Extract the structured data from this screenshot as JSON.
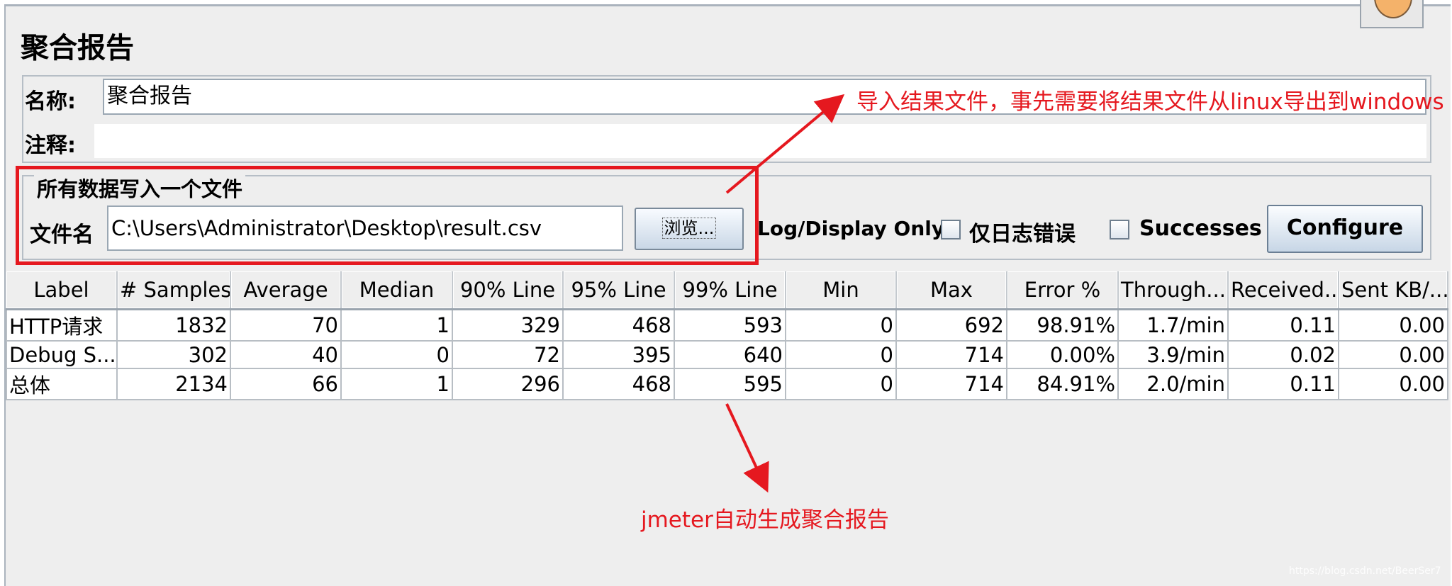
{
  "panel": {
    "title": "聚合报告",
    "name_label": "名称:",
    "name_value": "聚合报告",
    "comment_label": "注释:",
    "comment_value": ""
  },
  "file_group": {
    "title": "所有数据写入一个文件",
    "filename_label": "文件名",
    "filename_value": "C:\\Users\\Administrator\\Desktop\\result.csv",
    "browse_label": "浏览...",
    "log_display_label": "Log/Display Only:",
    "errors_label": "仅日志错误",
    "successes_label": "Successes",
    "configure_label": "Configure"
  },
  "table": {
    "headers": [
      "Label",
      "# Samples",
      "Average",
      "Median",
      "90% Line",
      "95% Line",
      "99% Line",
      "Min",
      "Max",
      "Error %",
      "Through...",
      "Received...",
      "Sent KB/..."
    ],
    "rows": [
      [
        "HTTP请求",
        "1832",
        "70",
        "1",
        "329",
        "468",
        "593",
        "0",
        "692",
        "98.91%",
        "1.7/min",
        "0.11",
        "0.00"
      ],
      [
        "Debug S...",
        "302",
        "40",
        "0",
        "72",
        "395",
        "640",
        "0",
        "714",
        "0.00%",
        "3.9/min",
        "0.02",
        "0.00"
      ],
      [
        "总体",
        "2134",
        "66",
        "1",
        "296",
        "468",
        "595",
        "0",
        "714",
        "84.91%",
        "2.0/min",
        "0.11",
        "0.00"
      ]
    ]
  },
  "annotations": {
    "import_note": "导入结果文件，事先需要将结果文件从linux导出到windows",
    "auto_note": "jmeter自动生成聚合报告"
  },
  "watermark": "https://blog.csdn.net/BeerSer7",
  "colors": {
    "annotation_red": "#e5181f",
    "panel_bg": "#eeeeee"
  }
}
